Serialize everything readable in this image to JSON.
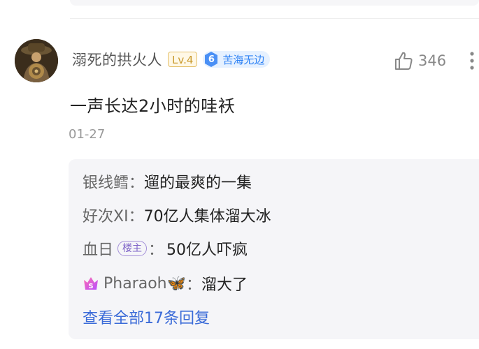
{
  "comment": {
    "username": "溺死的拱火人",
    "level_badge": "Lv.4",
    "fan_badge": {
      "level": "6",
      "name": "苦海无边"
    },
    "like_count": "346",
    "text": "一声长达2小时的哇袄",
    "date": "01-27"
  },
  "replies": [
    {
      "name": "银线鳕",
      "colon": "：",
      "text": "遛的最爽的一集"
    },
    {
      "name": "好次XI",
      "colon": "：",
      "text": "70亿人集体溜大冰"
    },
    {
      "name": "血日",
      "badge": "楼主",
      "colon": "：",
      "text": "50亿人吓疯"
    },
    {
      "name": "Pharaoh🦋",
      "colon": "：",
      "text": "溜大了"
    }
  ],
  "view_all": "查看全部17条回复",
  "colors": {
    "link": "#3b6bd8",
    "fan_badge_bg": "#e6f1ff",
    "fan_badge_text": "#2e82f5",
    "op_badge": "#7d62c7"
  }
}
